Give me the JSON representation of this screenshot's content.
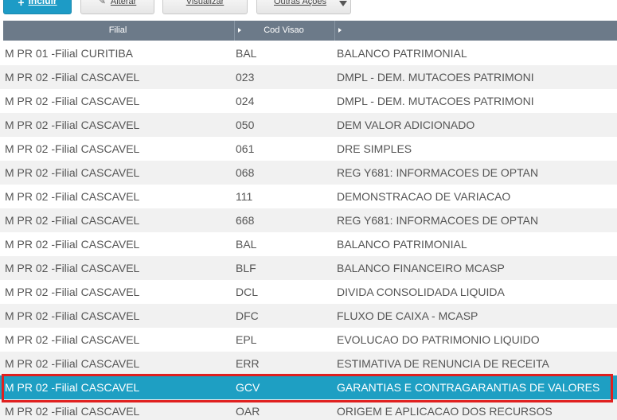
{
  "toolbar": {
    "incluir": "Incluir",
    "alterar": "Alterar",
    "visualizar": "Visualizar",
    "outras_acoes": "Outras Ações"
  },
  "header": {
    "filial": "Filial",
    "cod_visao": "Cod Visao"
  },
  "rows": [
    {
      "filial": "M PR 01 -Filial CURITIBA",
      "cod": "BAL",
      "desc": "BALANCO PATRIMONIAL"
    },
    {
      "filial": "M PR 02 -Filial CASCAVEL",
      "cod": "023",
      "desc": "DMPL - DEM. MUTACOES PATRIMONI"
    },
    {
      "filial": "M PR 02 -Filial CASCAVEL",
      "cod": "024",
      "desc": "DMPL - DEM. MUTACOES PATRIMONI"
    },
    {
      "filial": "M PR 02 -Filial CASCAVEL",
      "cod": "050",
      "desc": "DEM VALOR ADICIONADO"
    },
    {
      "filial": "M PR 02 -Filial CASCAVEL",
      "cod": "061",
      "desc": "DRE SIMPLES"
    },
    {
      "filial": "M PR 02 -Filial CASCAVEL",
      "cod": "068",
      "desc": "REG Y681: INFORMACOES DE OPTAN"
    },
    {
      "filial": "M PR 02 -Filial CASCAVEL",
      "cod": "111",
      "desc": "DEMONSTRACAO DE VARIACAO"
    },
    {
      "filial": "M PR 02 -Filial CASCAVEL",
      "cod": "668",
      "desc": "REG Y681: INFORMACOES DE OPTAN"
    },
    {
      "filial": "M PR 02 -Filial CASCAVEL",
      "cod": "BAL",
      "desc": "BALANCO PATRIMONIAL"
    },
    {
      "filial": "M PR 02 -Filial CASCAVEL",
      "cod": "BLF",
      "desc": "BALANCO FINANCEIRO MCASP"
    },
    {
      "filial": "M PR 02 -Filial CASCAVEL",
      "cod": "DCL",
      "desc": "DIVIDA CONSOLIDADA LIQUIDA"
    },
    {
      "filial": "M PR 02 -Filial CASCAVEL",
      "cod": "DFC",
      "desc": "FLUXO DE CAIXA - MCASP"
    },
    {
      "filial": "M PR 02 -Filial CASCAVEL",
      "cod": "EPL",
      "desc": "EVOLUCAO DO PATRIMONIO LIQUIDO"
    },
    {
      "filial": "M PR 02 -Filial CASCAVEL",
      "cod": "ERR",
      "desc": "ESTIMATIVA DE RENUNCIA DE RECEITA"
    },
    {
      "filial": "M PR 02 -Filial CASCAVEL",
      "cod": "GCV",
      "desc": "GARANTIAS E CONTRAGARANTIAS DE VALORES"
    },
    {
      "filial": "M PR 02 -Filial CASCAVEL",
      "cod": "OAR",
      "desc": "ORIGEM E APLICACAO DOS RECURSOS"
    }
  ],
  "selected_row_index": 14,
  "colors": {
    "header_bg": "#6c7a89",
    "selected_bg": "#1e9fc3",
    "primary_button": "#1d9bc6",
    "highlight_border": "#e0201f"
  },
  "icons": {
    "incluir": "plus-icon",
    "alterar": "pencil-icon",
    "outras_acoes": "caret-down-icon"
  }
}
